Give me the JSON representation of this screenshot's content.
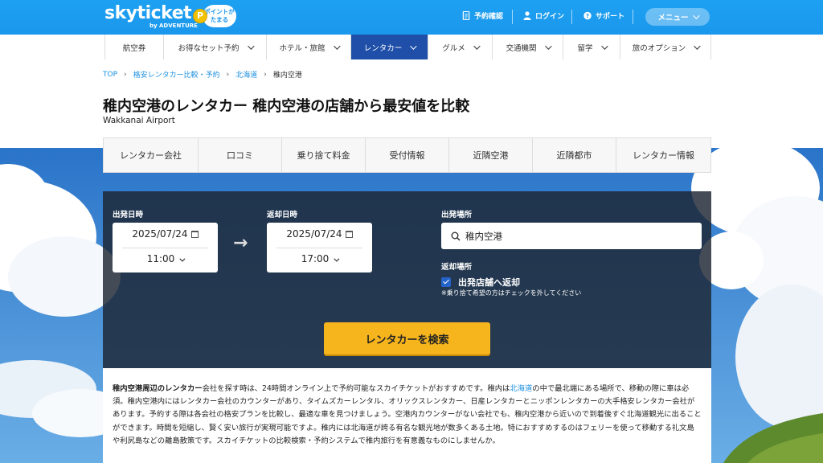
{
  "header": {
    "logo": "skyticket",
    "logo_sub": "by ADVENTURE",
    "points_badge": "ポイントが\nたまる",
    "links": [
      {
        "label": "予約確認",
        "icon": "document-icon"
      },
      {
        "label": "ログイン",
        "icon": "user-icon"
      },
      {
        "label": "サポート",
        "icon": "question-icon"
      }
    ],
    "menu_label": "メニュー"
  },
  "nav": {
    "items": [
      {
        "label": "航空券"
      },
      {
        "label": "お得なセット予約"
      },
      {
        "label": "ホテル・旅館"
      },
      {
        "label": "レンタカー",
        "active": true
      },
      {
        "label": "グルメ"
      },
      {
        "label": "交通機関"
      },
      {
        "label": "留学"
      },
      {
        "label": "旅のオプション"
      }
    ]
  },
  "breadcrumb": [
    "TOP",
    "格安レンタカー比較・予約",
    "北海道",
    "稚内空港"
  ],
  "page": {
    "title": "稚内空港のレンタカー 稚内空港の店舗から最安値を比較",
    "subtitle": "Wakkanai Airport"
  },
  "tabs": [
    "レンタカー会社",
    "口コミ",
    "乗り捨て料金",
    "受付情報",
    "近隣空港",
    "近隣都市",
    "レンタカー情報"
  ],
  "search": {
    "depart_label": "出発日時",
    "depart_date": "2025/07/24",
    "depart_time": "11:00",
    "return_label": "返却日時",
    "return_date": "2025/07/24",
    "return_time": "17:00",
    "depart_place_label": "出発場所",
    "depart_place_value": "稚内空港",
    "return_place_label": "返却場所",
    "same_store_label": "出発店舗へ返却",
    "same_store_checked": true,
    "same_store_note": "※乗り捨て希望の方はチェックを外してください",
    "search_button": "レンタカーを検索"
  },
  "description": {
    "lead_bold": "稚内空港周辺のレンタカー",
    "text_1": "会社を探す時は、24時間オンライン上で予約可能なスカイチケットがおすすめです。稚内は",
    "link": "北海道",
    "text_2": "の中で最北端にある場所で、移動の際に車は必須。稚内空港内にはレンタカー会社のカウンターがあり、タイムズカーレンタル、オリックスレンタカー、日産レンタカーとニッポンレンタカーの大手格安レンタカー会社があります。予約する際は各会社の格安プランを比較し、最適な車を見つけましょう。空港内カウンターがない会社でも、稚内空港から近いので到着後すぐ北海道観光に出ることができます。時間を短縮し、賢く安い旅行が実現可能ですよ。稚内には北海道が誇る有名な観光地が数多くある土地。特におすすめするのはフェリーを使って移動する礼文島や利尻島などの離島散策です。スカイチケットの比較検索・予約システムで稚内旅行を有意義なものにしませんか。"
  },
  "colors": {
    "header_blue": "#1a97ec",
    "nav_active": "#1f4fa8",
    "search_button": "#f6b41d",
    "link": "#1a8fdf"
  }
}
